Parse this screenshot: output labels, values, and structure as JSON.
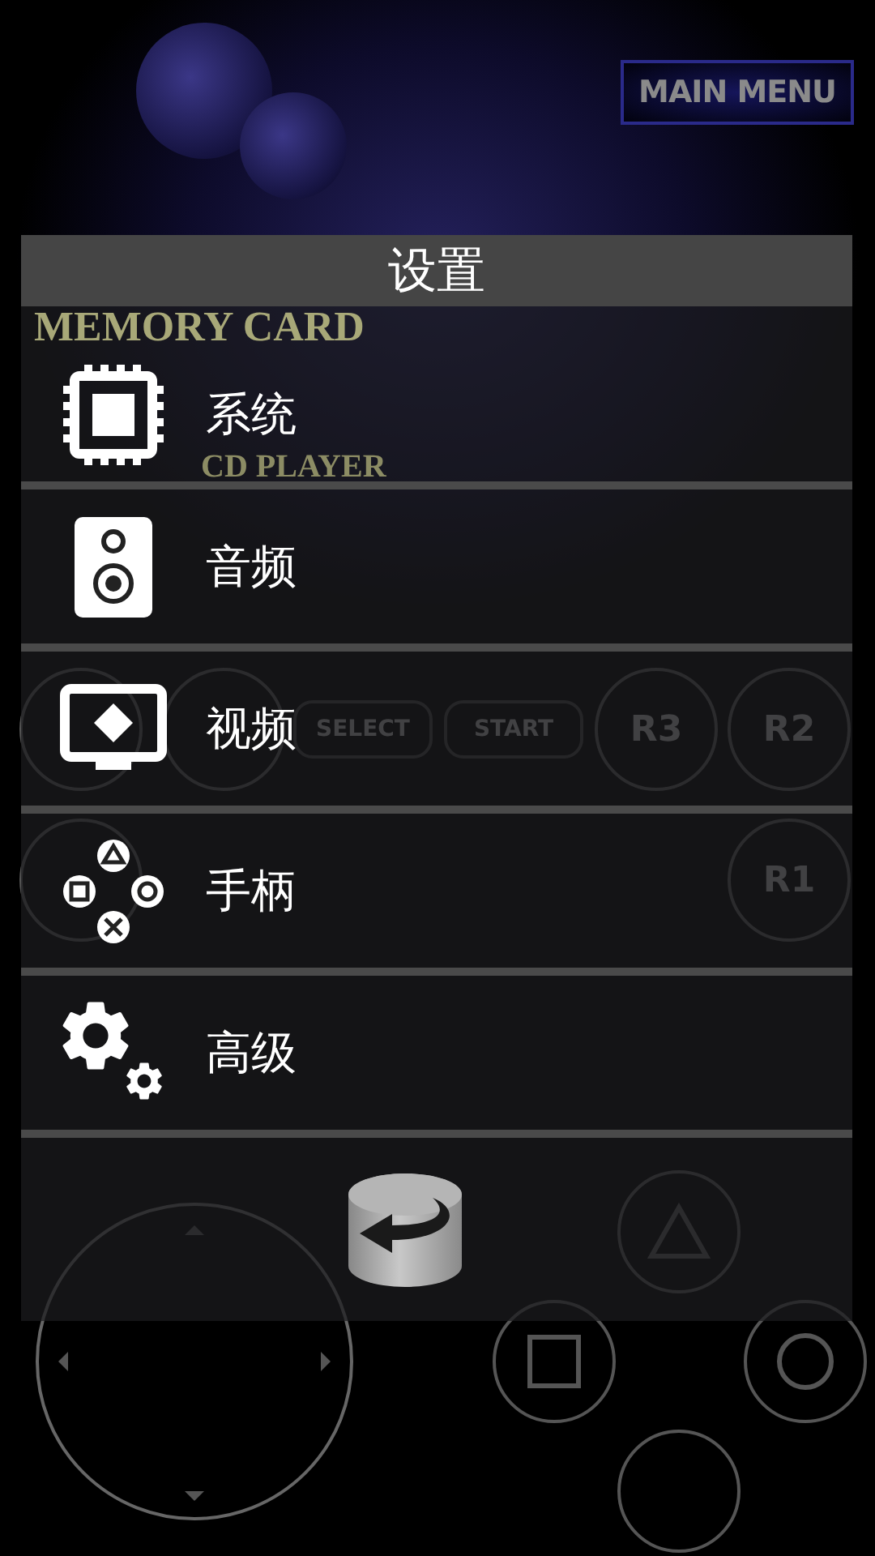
{
  "main_menu_button": {
    "label": "MAIN MENU"
  },
  "background": {
    "memory_card_label": "MEMORY CARD",
    "cd_player_label": "CD PLAYER",
    "controls": [
      {
        "kind": "l2"
      },
      {
        "kind": "l3"
      },
      {
        "kind": "select",
        "label": "SELECT"
      },
      {
        "kind": "start",
        "label": "START"
      },
      {
        "kind": "r3",
        "label": "R3"
      },
      {
        "kind": "r2",
        "label": "R2"
      },
      {
        "kind": "l1"
      },
      {
        "kind": "r1",
        "label": "R1"
      },
      {
        "kind": "dpad"
      },
      {
        "kind": "triangle"
      },
      {
        "kind": "square"
      },
      {
        "kind": "circle"
      },
      {
        "kind": "cross"
      }
    ]
  },
  "dialog": {
    "title": "设置",
    "items": [
      {
        "kind": "chip",
        "label": "系统"
      },
      {
        "kind": "speaker",
        "label": "音频"
      },
      {
        "kind": "monitor",
        "label": "视频"
      },
      {
        "kind": "gamepad",
        "label": "手柄"
      },
      {
        "kind": "gears",
        "label": "高级"
      }
    ],
    "back_button": {
      "kind": "back"
    }
  }
}
